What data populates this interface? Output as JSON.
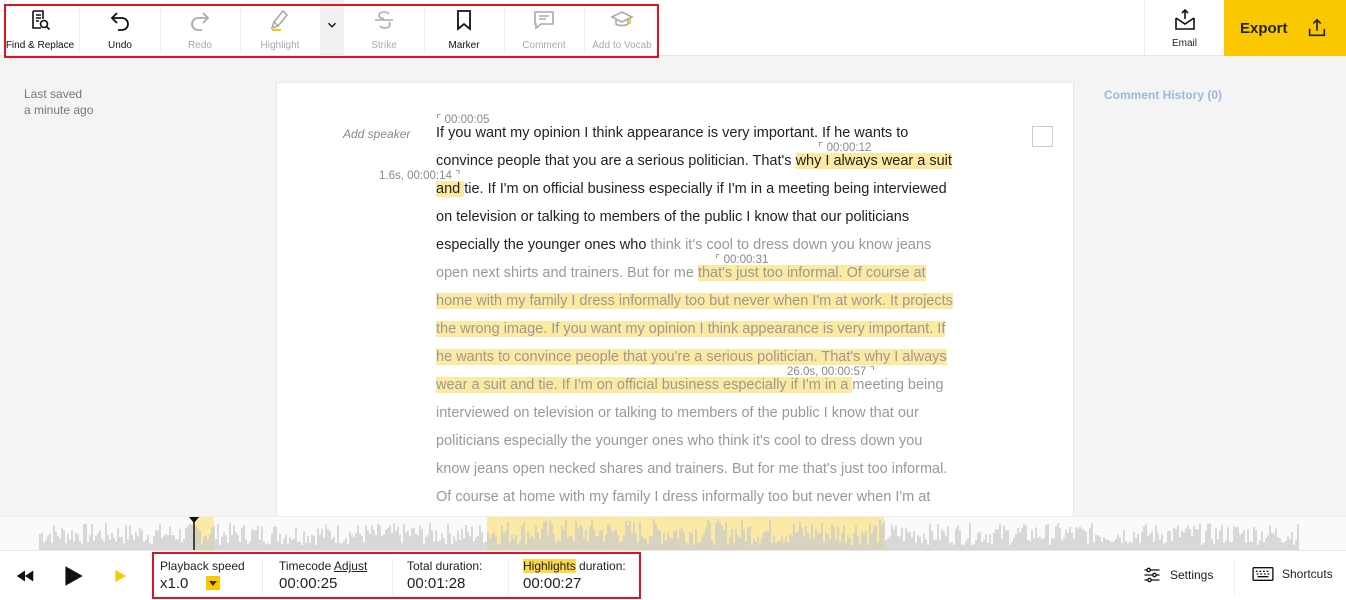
{
  "toolbar": {
    "find_replace": "Find & Replace",
    "undo": "Undo",
    "redo": "Redo",
    "highlight": "Highlight",
    "strike": "Strike",
    "marker": "Marker",
    "comment": "Comment",
    "add_to_vocab": "Add to Vocab",
    "email": "Email",
    "export": "Export"
  },
  "status": {
    "last_saved_line1": "Last saved",
    "last_saved_line2": "a minute ago",
    "comment_history": "Comment History (0)"
  },
  "transcript": {
    "speaker_placeholder": "Add speaker",
    "timecodes": {
      "tc1": "00:00:05",
      "tc2": "00:00:12",
      "tc3": "1.6s, 00:00:14",
      "tc4": "00:00:31",
      "tc5": "26.0s, 00:00:57"
    },
    "lines": [
      [
        {
          "t": "If you want my opinion I think appearance is very important. If he wants to",
          "c": "dark"
        }
      ],
      [
        {
          "t": "convince people that you are a serious politician. That's ",
          "c": "dark"
        },
        {
          "t": "why I always wear a suit",
          "c": "dark",
          "h": true
        }
      ],
      [
        {
          "t": "and ",
          "c": "dark",
          "h": true
        },
        {
          "t": "tie. If I'm on official business especially if I'm in a meeting being interviewed",
          "c": "dark"
        }
      ],
      [
        {
          "t": "on television or talking to members of the public I know that our politicians",
          "c": "dark"
        }
      ],
      [
        {
          "t": "especially the younger ones who ",
          "c": "dark"
        },
        {
          "t": "think it's cool to dress down you know jeans",
          "c": "grey"
        }
      ],
      [
        {
          "t": "open next shirts and trainers. But for me ",
          "c": "grey"
        },
        {
          "t": "that's just too informal. Of course at",
          "c": "grey",
          "h": true
        }
      ],
      [
        {
          "t": "home with my family I dress informally too but never when I'm at work. It projects",
          "c": "grey",
          "h": true
        }
      ],
      [
        {
          "t": "the wrong image. If you want my opinion I think appearance is very important. If",
          "c": "grey",
          "h": true
        }
      ],
      [
        {
          "t": "he wants to convince people that you're a serious politician. That's why I always",
          "c": "grey",
          "h": true
        }
      ],
      [
        {
          "t": "wear a suit and tie. If I'm on official business especially if I'm in a ",
          "c": "grey",
          "h": true
        },
        {
          "t": "meeting being",
          "c": "grey"
        }
      ],
      [
        {
          "t": "interviewed on television or talking to members of the public I know that our",
          "c": "grey"
        }
      ],
      [
        {
          "t": "politicians especially the younger ones who think it's cool to dress down you",
          "c": "grey"
        }
      ],
      [
        {
          "t": "know jeans open necked shares and trainers. But for me that's just too informal.",
          "c": "grey"
        }
      ],
      [
        {
          "t": "Of course at home with my family I dress informally too but never when I'm at",
          "c": "grey"
        }
      ]
    ]
  },
  "player": {
    "playback_speed_label": "Playback speed",
    "playback_speed_value": "x1.0",
    "timecode_label": "Timecode",
    "timecode_adjust": "Adjust",
    "timecode_value": "00:00:25",
    "total_duration_label": "Total duration:",
    "total_duration_value": "00:01:28",
    "highlights_word": "Highlights",
    "highlights_duration_label": " duration:",
    "highlights_duration_value": "00:00:27",
    "settings": "Settings",
    "shortcuts": "Shortcuts"
  },
  "colors": {
    "accent": "#f9c800",
    "highlight": "#fdeaa0",
    "annotation_box": "#e0141e"
  }
}
